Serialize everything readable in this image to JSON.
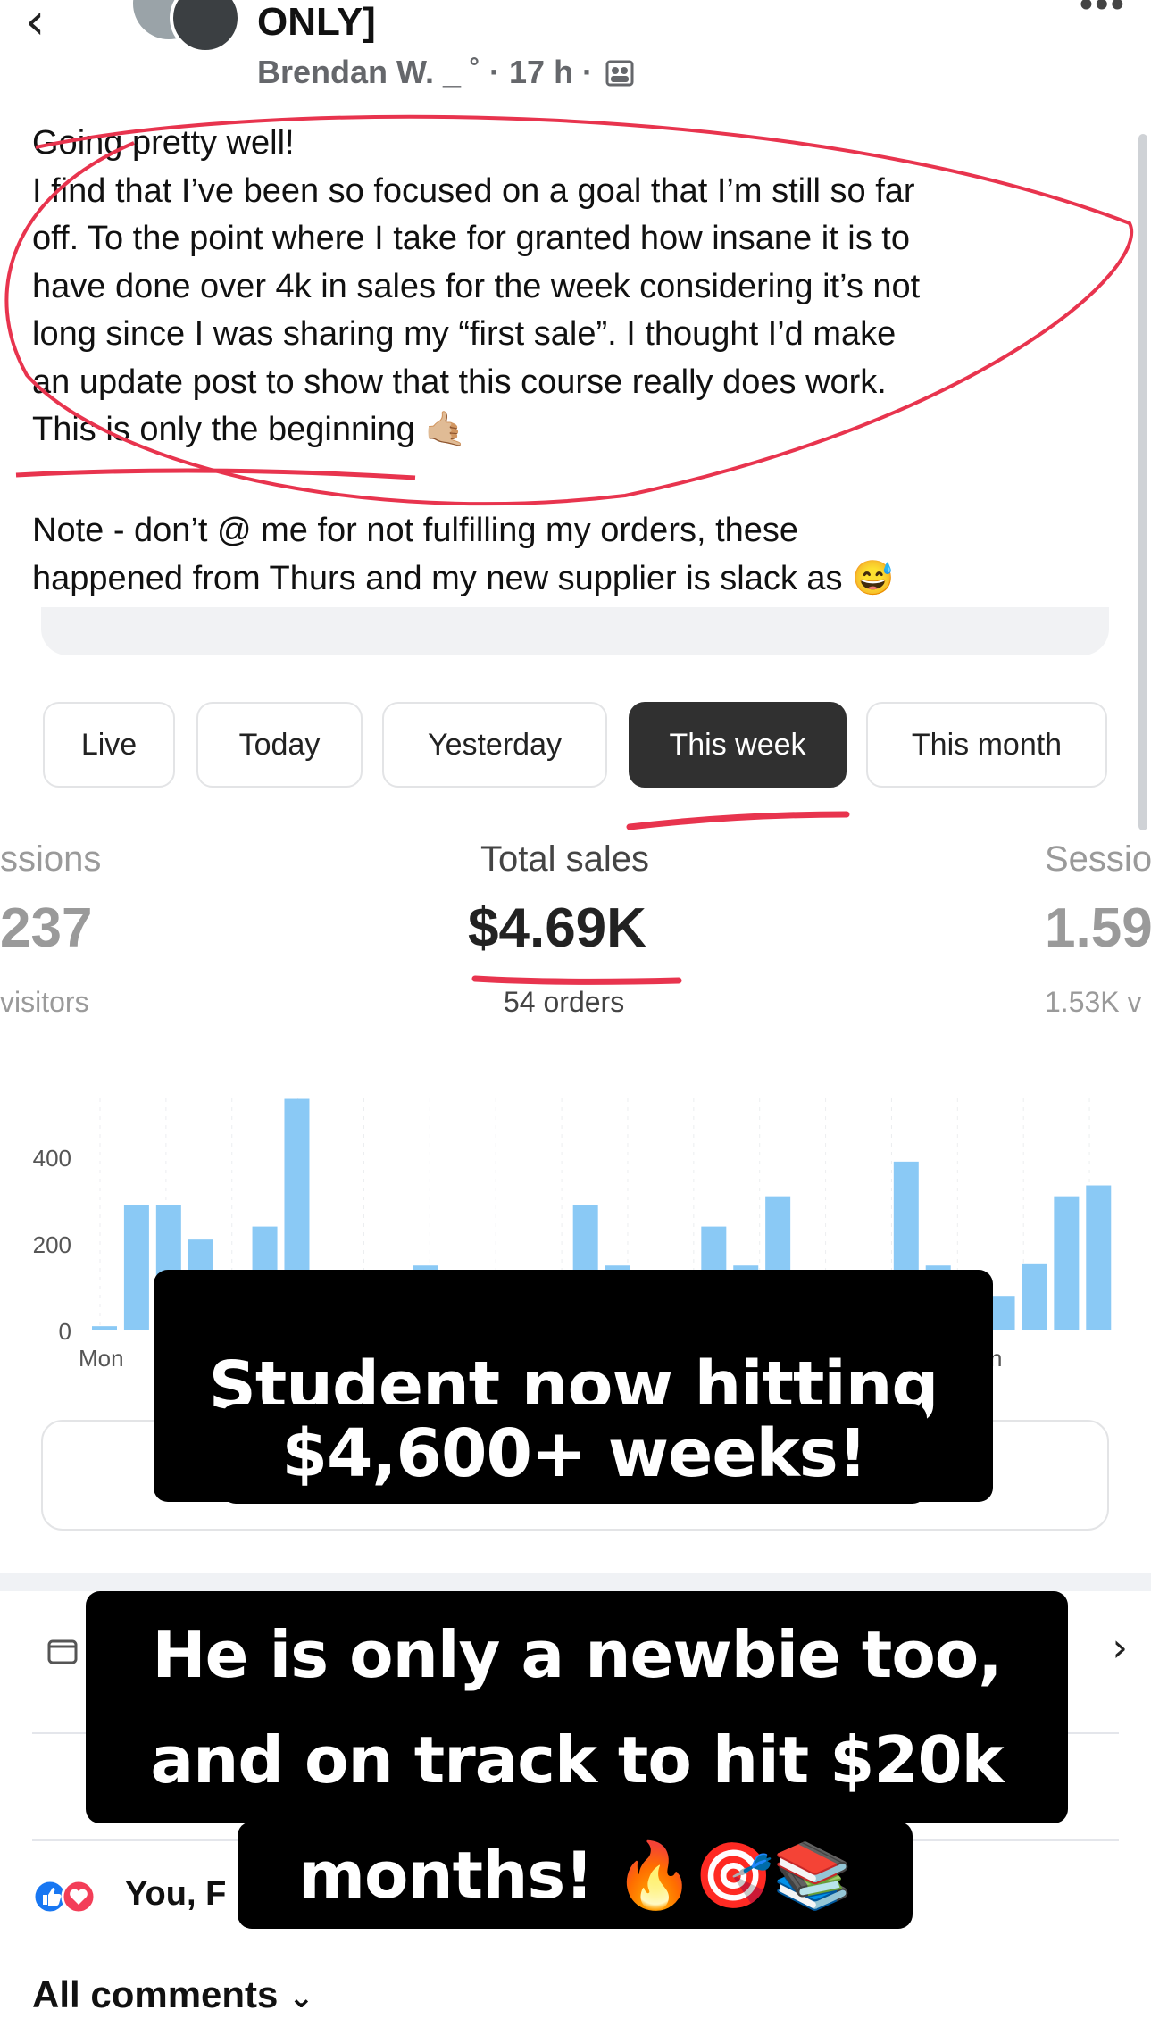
{
  "header": {
    "group_name": "ONLY]",
    "meta": "Brendan W. _ ˚ · 17 h ·",
    "more": "•••"
  },
  "post": {
    "lines": [
      "Going pretty well!",
      "I find that I’ve been so focused on a goal that I’m still so far",
      "off. To the point where I take for granted how insane it is to",
      "have done over 4k in sales for the week considering it’s not",
      "long since I was sharing my “first sale”. I thought I’d make",
      "an update post to show that this course really does work.",
      "This is only the beginning 🤙🏼"
    ],
    "note_lines": [
      "Note - don’t @ me for not fulfilling my orders, these",
      "happened from Thurs and my new supplier is slack as 😅"
    ]
  },
  "tabs": [
    {
      "label": "Live",
      "active": false
    },
    {
      "label": "Today",
      "active": false
    },
    {
      "label": "Yesterday",
      "active": false
    },
    {
      "label": "This week",
      "active": true
    },
    {
      "label": "This month",
      "active": false
    }
  ],
  "metrics": {
    "left": {
      "label": "ssions",
      "value": "237",
      "sub": "visitors"
    },
    "center": {
      "label": "Total sales",
      "value": "$4.69K",
      "sub": "54 orders"
    },
    "right": {
      "label": "Sessio",
      "value": "1.59",
      "sub": "1.53K v"
    }
  },
  "chart_data": {
    "type": "bar",
    "ylim": [
      0,
      550
    ],
    "y_ticks": [
      "0",
      "200",
      "400"
    ],
    "x_tick_labels": [
      "Mon",
      "n"
    ],
    "values": [
      10,
      290,
      290,
      210,
      0,
      240,
      535,
      0,
      0,
      0,
      150,
      0,
      0,
      0,
      0,
      290,
      150,
      0,
      0,
      240,
      150,
      310,
      0,
      0,
      0,
      390,
      150,
      0,
      80,
      155,
      310,
      335
    ],
    "color": "#8ac9f5"
  },
  "reactions": {
    "names": "You, F"
  },
  "comments": {
    "label": "All comments",
    "chevron": "⌄"
  },
  "overlays": {
    "caption1_line1": "Student now hitting",
    "caption1_line2": "$4,600+ weeks!",
    "caption2_line1": "He is only a newbie too,",
    "caption2_line2": "and on track to hit $20k",
    "caption2_line3": "months! 🔥🎯📚"
  },
  "colors": {
    "annotation_red": "#e8344e",
    "active_tab": "#303030",
    "bar": "#8ac9f5",
    "like_blue": "#1877f2",
    "love_red": "#f33e58"
  }
}
